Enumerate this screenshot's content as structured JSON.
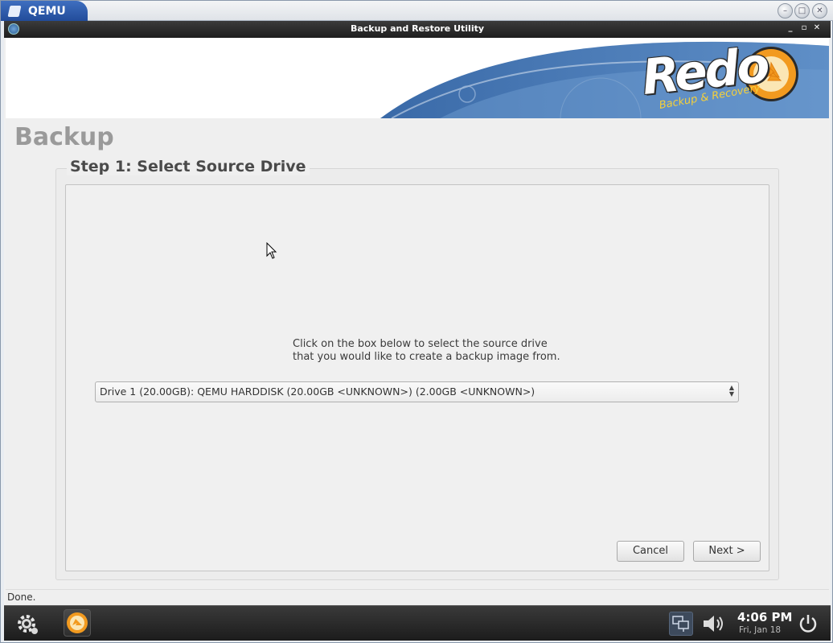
{
  "host": {
    "tab_title": "QEMU"
  },
  "app": {
    "window_title": "Backup and Restore Utility"
  },
  "banner": {
    "logo_text": "Redo",
    "logo_subtitle": "Backup & Recovery",
    "accent_color": "#f29a1f",
    "wave_color": "#2f5c99"
  },
  "page": {
    "title": "Backup",
    "step_title": "Step 1: Select Source Drive",
    "instruction_line1": "Click on the box below to select the source drive",
    "instruction_line2": "that you would like to create a backup image from.",
    "drive_select_value": "Drive 1 (20.00GB): QEMU HARDDISK (20.00GB <UNKNOWN>) (2.00GB <UNKNOWN>)",
    "cancel_label": "Cancel",
    "next_label": "Next >"
  },
  "status": {
    "text": "Done."
  },
  "taskbar": {
    "settings_icon": "gear-icon",
    "app_icon": "redo-recycle-icon",
    "network_icon": "network-icon",
    "volume_icon": "volume-icon",
    "power_icon": "power-icon",
    "time": "4:06 PM",
    "date": "Fri, Jan 18"
  }
}
